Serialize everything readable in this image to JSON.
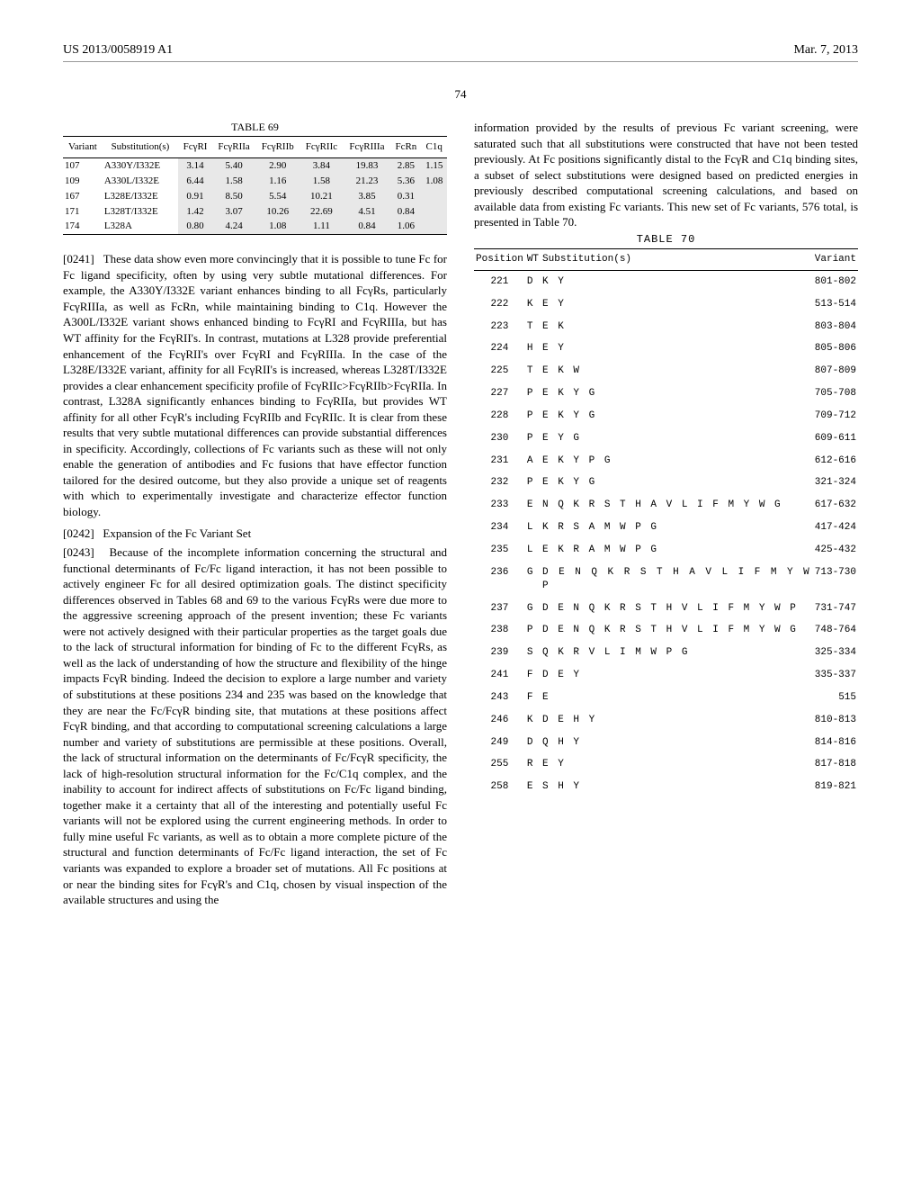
{
  "header": {
    "pub_number": "US 2013/0058919 A1",
    "date": "Mar. 7, 2013",
    "page": "74"
  },
  "table69": {
    "caption": "TABLE 69",
    "headers": [
      "Variant",
      "Substitution(s)",
      "FcγRI",
      "FcγRIIa",
      "FcγRIIb",
      "FcγRIIc",
      "FcγRIIIa",
      "FcRn",
      "C1q"
    ],
    "rows": [
      [
        "107",
        "A330Y/I332E",
        "3.14",
        "5.40",
        "2.90",
        "3.84",
        "19.83",
        "2.85",
        "1.15"
      ],
      [
        "109",
        "A330L/I332E",
        "6.44",
        "1.58",
        "1.16",
        "1.58",
        "21.23",
        "5.36",
        "1.08"
      ],
      [
        "167",
        "L328E/I332E",
        "0.91",
        "8.50",
        "5.54",
        "10.21",
        "3.85",
        "0.31",
        ""
      ],
      [
        "171",
        "L328T/I332E",
        "1.42",
        "3.07",
        "10.26",
        "22.69",
        "4.51",
        "0.84",
        ""
      ],
      [
        "174",
        "L328A",
        "0.80",
        "4.24",
        "1.08",
        "1.11",
        "0.84",
        "1.06",
        ""
      ]
    ]
  },
  "left": {
    "p241_num": "[0241]",
    "p241": "These data show even more convincingly that it is possible to tune Fc for Fc ligand specificity, often by using very subtle mutational differences. For example, the A330Y/I332E variant enhances binding to all FcγRs, particularly FcγRIIIa, as well as FcRn, while maintaining binding to C1q. However the A300L/I332E variant shows enhanced binding to FcγRI and FcγRIIIa, but has WT affinity for the FcγRII's. In contrast, mutations at L328 provide preferential enhancement of the FcγRII's over FcγRI and FcγRIIIa. In the case of the L328E/I332E variant, affinity for all FcγRII's is increased, whereas L328T/I332E provides a clear enhancement specificity profile of FcγRIIc>FcγRIIb>FcγRIIa. In contrast, L328A significantly enhances binding to FcγRIIa, but provides WT affinity for all other FcγR's including FcγRIIb and FcγRIIc. It is clear from these results that very subtle mutational differences can provide substantial differences in specificity. Accordingly, collections of Fc variants such as these will not only enable the generation of antibodies and Fc fusions that have effector function tailored for the desired outcome, but they also provide a unique set of reagents with which to experimentally investigate and characterize effector function biology.",
    "p242_num": "[0242]",
    "p242": "Expansion of the Fc Variant Set",
    "p243_num": "[0243]",
    "p243": "Because of the incomplete information concerning the structural and functional determinants of Fc/Fc ligand interaction, it has not been possible to actively engineer Fc for all desired optimization goals. The distinct specificity differences observed in Tables 68 and 69 to the various FcγRs were due more to the aggressive screening approach of the present invention; these Fc variants were not actively designed with their particular properties as the target goals due to the lack of structural information for binding of Fc to the different FcγRs, as well as the lack of understanding of how the structure and flexibility of the hinge impacts FcγR binding. Indeed the decision to explore a large number and variety of substitutions at these positions 234 and 235 was based on the knowledge that they are near the Fc/FcγR binding site, that mutations at these positions affect FcγR binding, and that according to computational screening calculations a large number and variety of substitutions are permissible at these positions. Overall, the lack of structural information on the determinants of Fc/FcγR specificity, the lack of high-resolution structural information for the Fc/C1q complex, and the inability to account for indirect affects of substitutions on Fc/Fc ligand binding, together make it a certainty that all of the interesting and potentially useful Fc variants will not be explored using the current engineering methods. In order to fully mine useful Fc variants, as well as to obtain a more complete picture of the structural and function determinants of Fc/Fc ligand interaction, the set of Fc variants was expanded to explore a broader set of mutations. All Fc positions at or near the binding sites for FcγR's and C1q, chosen by visual inspection of the available structures and using the"
  },
  "right": {
    "intro": "information provided by the results of previous Fc variant screening, were saturated such that all substitutions were constructed that have not been tested previously. At Fc positions significantly distal to the FcγR and C1q binding sites, a subset of select substitutions were designed based on predicted energies in previously described computational screening calculations, and based on available data from existing Fc variants. This new set of Fc variants, 576 total, is presented in Table 70."
  },
  "table70": {
    "caption": "TABLE 70",
    "headers": [
      "Position",
      "WT",
      "Substitution(s)",
      "Variant"
    ],
    "rows": [
      [
        "221",
        "D",
        "K Y",
        "801-802"
      ],
      [
        "222",
        "K",
        "E Y",
        "513-514"
      ],
      [
        "223",
        "T",
        "E K",
        "803-804"
      ],
      [
        "224",
        "H",
        "E Y",
        "805-806"
      ],
      [
        "225",
        "T",
        "E K W",
        "807-809"
      ],
      [
        "227",
        "P",
        "E K Y G",
        "705-708"
      ],
      [
        "228",
        "P",
        "E K Y G",
        "709-712"
      ],
      [
        "230",
        "P",
        "E Y G",
        "609-611"
      ],
      [
        "231",
        "A",
        "E K Y P G",
        "612-616"
      ],
      [
        "232",
        "P",
        "E K Y G",
        "321-324"
      ],
      [
        "233",
        "E",
        "N Q K R S T H A V L I F M Y W G",
        "617-632"
      ],
      [
        "234",
        "L",
        "K R S A M W P G",
        "417-424"
      ],
      [
        "235",
        "L",
        "E K R A M W P G",
        "425-432"
      ],
      [
        "236",
        "G",
        "D E N Q K R S T H A V L I F M Y W P",
        "713-730"
      ],
      [
        "237",
        "G",
        "D E N Q K R S T H V L I F M Y W P",
        "731-747"
      ],
      [
        "238",
        "P",
        "D E N Q K R S T H V L I F M Y W G",
        "748-764"
      ],
      [
        "239",
        "S",
        "Q K R V L I M W P G",
        "325-334"
      ],
      [
        "241",
        "F",
        "D E Y",
        "335-337"
      ],
      [
        "243",
        "F",
        "E",
        "515"
      ],
      [
        "246",
        "K",
        "D E H Y",
        "810-813"
      ],
      [
        "249",
        "D",
        "Q H Y",
        "814-816"
      ],
      [
        "255",
        "R",
        "E Y",
        "817-818"
      ],
      [
        "258",
        "E",
        "S H Y",
        "819-821"
      ]
    ]
  }
}
